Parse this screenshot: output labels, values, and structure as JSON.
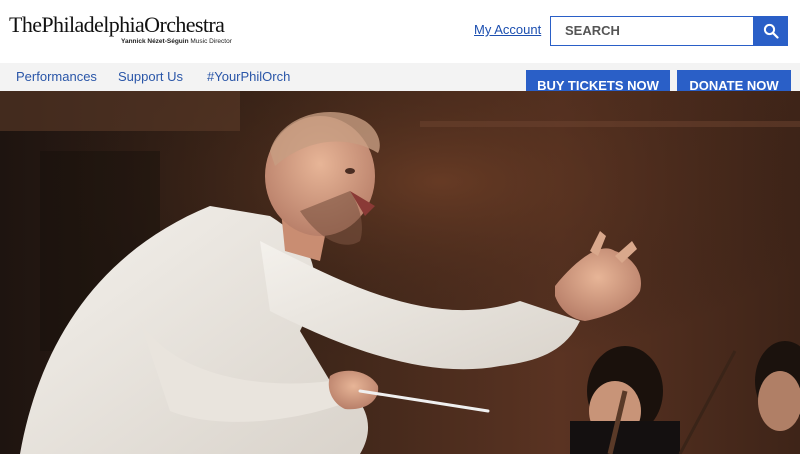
{
  "header": {
    "logo_main": "ThePhiladelphiaOrchestra",
    "logo_sub_name": "Yannick Nézet-Séguin",
    "logo_sub_role": " Music Director",
    "my_account": "My Account",
    "search_placeholder": "SEARCH"
  },
  "nav": {
    "items": [
      {
        "label": "Performances"
      },
      {
        "label": "Support Us"
      },
      {
        "label": "#YourPhilOrch"
      }
    ]
  },
  "cta": {
    "buy_tickets": "BUY TICKETS NOW",
    "donate": "DONATE NOW"
  },
  "colors": {
    "accent": "#2a5fc7",
    "link": "#1c4fb0",
    "nav_bg": "#f3f3f3"
  },
  "icons": {
    "search": "search-icon"
  }
}
